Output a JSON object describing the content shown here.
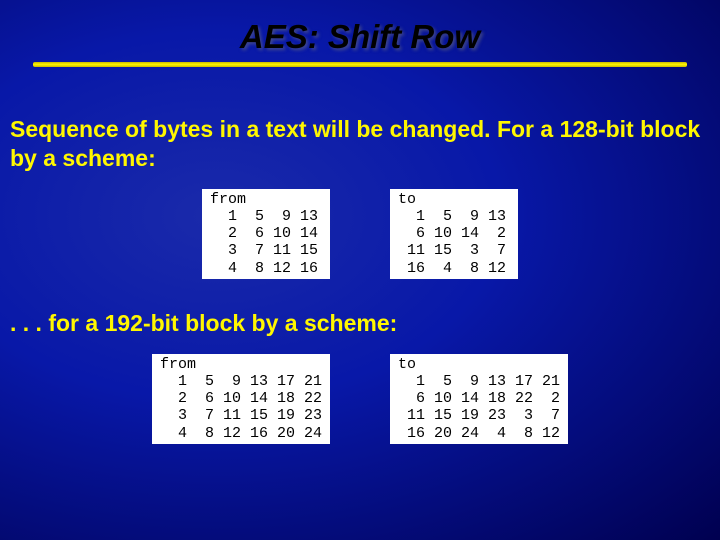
{
  "title": "AES: Shift Row",
  "para1": "Sequence of bytes in a text will be changed. For a 128-bit block by a scheme:",
  "para2": ". . . for a 192-bit block by a scheme:",
  "block128": {
    "from_header": "from",
    "from_rows": [
      [
        1,
        5,
        9,
        13
      ],
      [
        2,
        6,
        10,
        14
      ],
      [
        3,
        7,
        11,
        15
      ],
      [
        4,
        8,
        12,
        16
      ]
    ],
    "to_header": "to",
    "to_rows": [
      [
        1,
        5,
        9,
        13
      ],
      [
        6,
        10,
        14,
        2
      ],
      [
        11,
        15,
        3,
        7
      ],
      [
        16,
        4,
        8,
        12
      ]
    ]
  },
  "block192": {
    "from_header": "from",
    "from_rows": [
      [
        1,
        5,
        9,
        13,
        17,
        21
      ],
      [
        2,
        6,
        10,
        14,
        18,
        22
      ],
      [
        3,
        7,
        11,
        15,
        19,
        23
      ],
      [
        4,
        8,
        12,
        16,
        20,
        24
      ]
    ],
    "to_header": "to",
    "to_rows": [
      [
        1,
        5,
        9,
        13,
        17,
        21
      ],
      [
        6,
        10,
        14,
        18,
        22,
        2
      ],
      [
        11,
        15,
        19,
        23,
        3,
        7
      ],
      [
        16,
        20,
        24,
        4,
        8,
        12
      ]
    ]
  }
}
